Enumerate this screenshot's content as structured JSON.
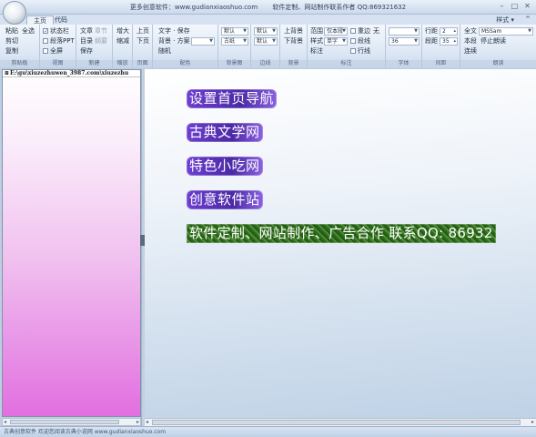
{
  "window": {
    "title_left": "更多创意软件：www.gudianxiaoshuo.com",
    "title_right": "软件定制、网站制作联系作者 QQ:869321632",
    "min_glyph": "–",
    "max_glyph": "□",
    "close_glyph": "✕"
  },
  "tabs": [
    {
      "label": "主页"
    },
    {
      "label": "代码"
    }
  ],
  "style_menu": "样式 ▾",
  "ribbon_caret": "^",
  "ribbon": {
    "clipboard": {
      "caption": "剪贴板",
      "paste": "粘贴",
      "select_all": "全选",
      "cut": "剪切",
      "copy": "复制"
    },
    "view": {
      "caption": "视图",
      "status_bar": "状态栏",
      "ppt": "段落PPT",
      "fullscreen": "全屏"
    },
    "create": {
      "caption": "新建",
      "article": "文章",
      "chapter": "章节",
      "toc": "目录",
      "outline": "纲要",
      "save": "保存"
    },
    "zoom": {
      "caption": "缩放",
      "enlarge": "增大",
      "shrink": "缩减"
    },
    "page": {
      "caption": "页面",
      "prev": "上页",
      "next": "下页"
    },
    "color": {
      "caption": "配色",
      "text_save": "文字 · 保存",
      "bg_scheme": "背景 · 方案",
      "random": "随机"
    },
    "font_bg": {
      "caption": "背景图",
      "default": "默认",
      "style": "古纸"
    },
    "border": {
      "caption": "边线",
      "default1": "默认",
      "default2": "默认"
    },
    "background": {
      "caption": "背景",
      "up": "上背景",
      "down": "下背景"
    },
    "mark": {
      "caption": "标注",
      "range": "范围",
      "range_val": "仅本段",
      "pattern": "样式",
      "pattern_val": "单字",
      "mark_btn": "标注",
      "highlight": "重边",
      "none": "无",
      "para_line": "段线",
      "row_line": "行线"
    },
    "font": {
      "caption": "字体",
      "size": "36"
    },
    "spacing": {
      "caption": "间距",
      "line_dist": "行距",
      "line_val": "2",
      "para_dist": "段距",
      "para_val": "35"
    },
    "read": {
      "caption": "朗读",
      "full": "全文",
      "voice": "MSSam",
      "this_para": "本段",
      "stop": "停止朗读",
      "continuous": "连续"
    }
  },
  "left_panel": {
    "path": "E:\\gu\\xiuzezhuwen_3987.com\\xiuzezhu"
  },
  "main": {
    "links": [
      {
        "text": "设置首页导航"
      },
      {
        "text": "古典文学网"
      },
      {
        "text": "特色小吃网"
      },
      {
        "text": "创意软件站"
      },
      {
        "text": "软件定制、网站制作、广告合作 联系QQ: 86932"
      }
    ]
  },
  "status": {
    "text": "古典创意软件 欢迎您阅读古典小说网  www.gudianxiaoshuo.com"
  }
}
